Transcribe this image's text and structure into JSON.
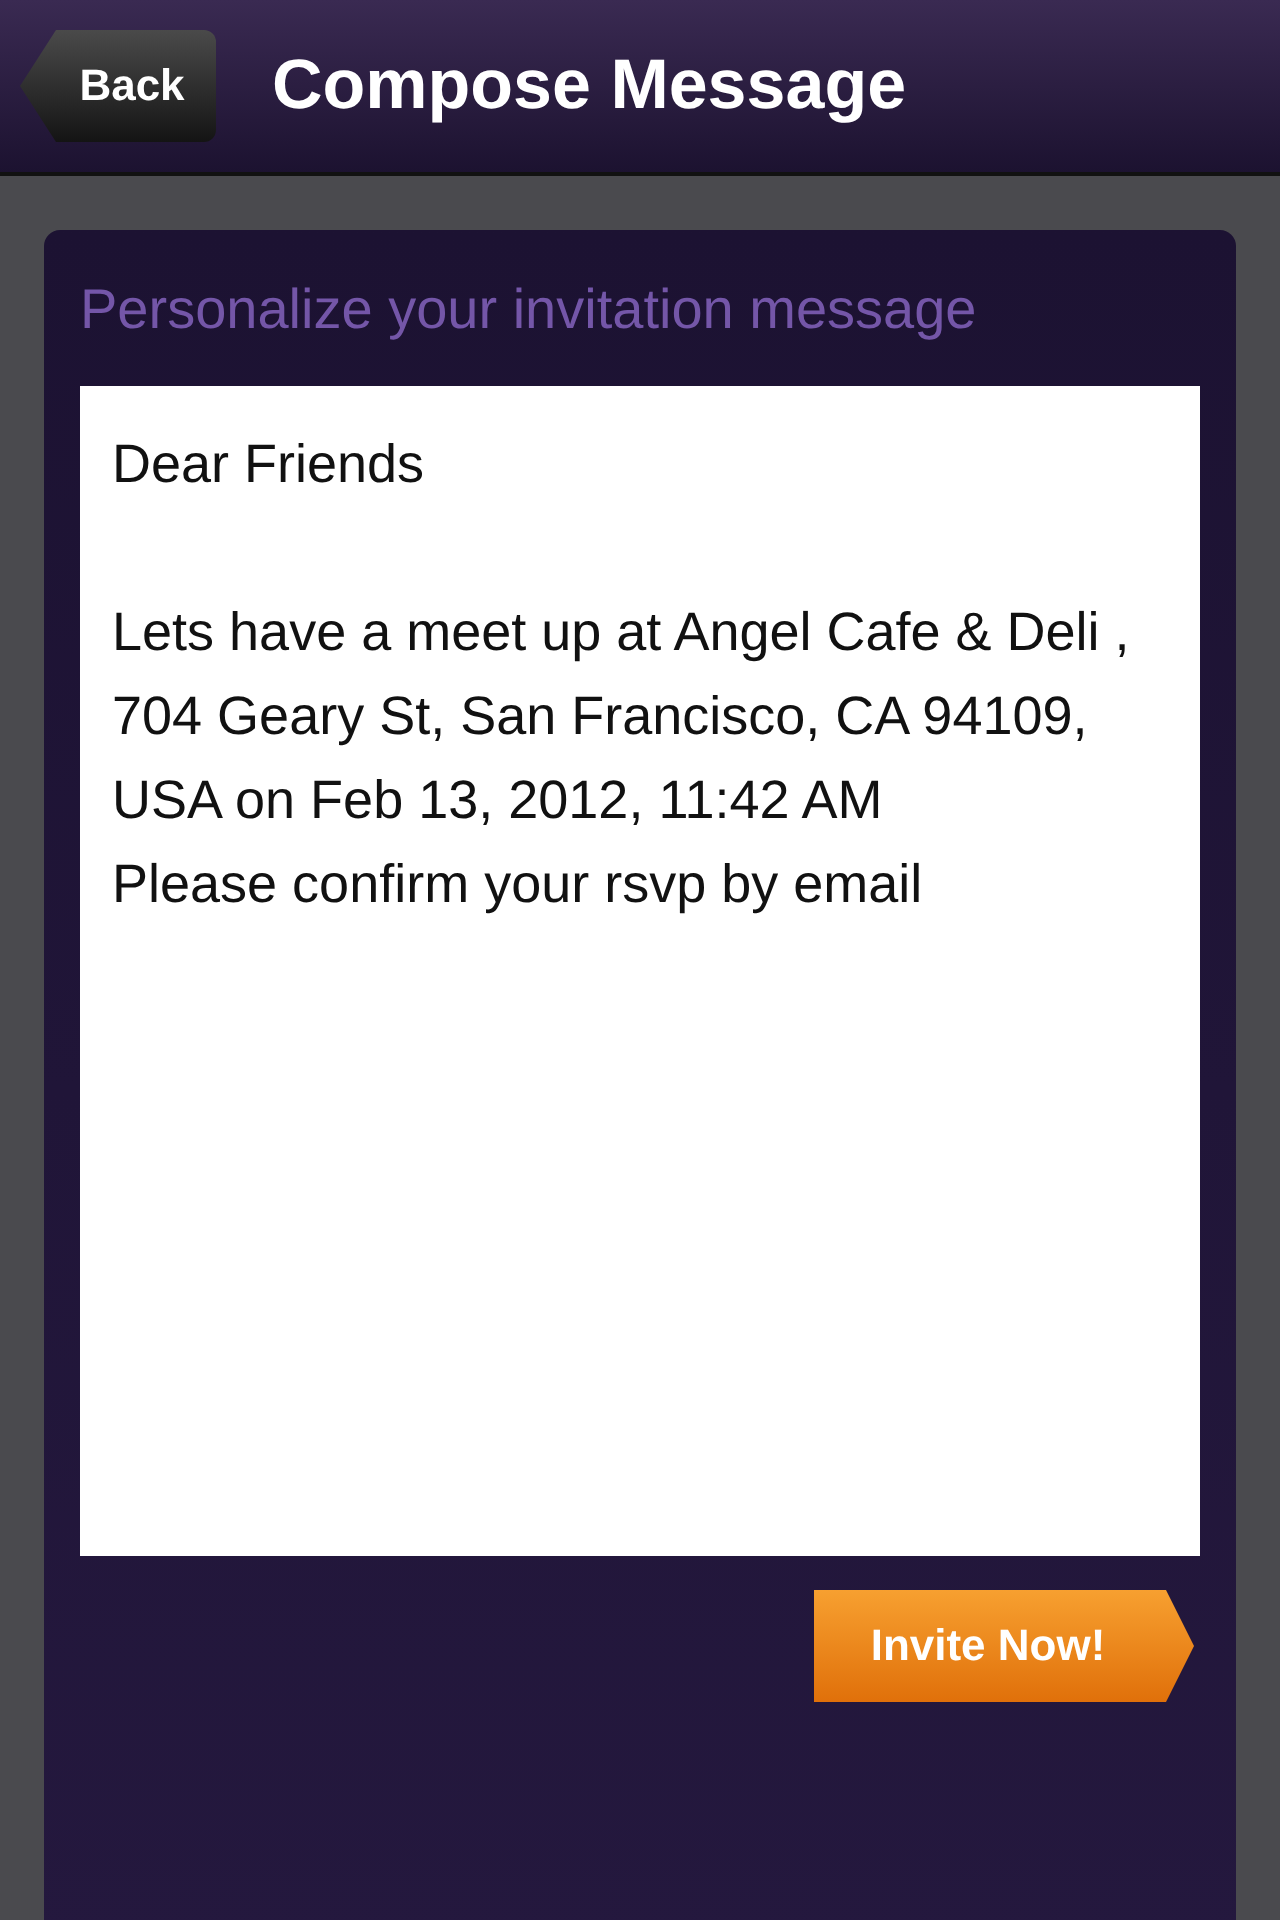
{
  "nav_bar": {
    "back_button": "Back",
    "title": "Compose Message"
  },
  "panel": {
    "heading": "Personalize your invitation message",
    "message": {
      "value": "Dear Friends\n\nLets have a meet up at Angel Cafe & Deli ,\n704 Geary St, San Francisco, CA 94109, USA on Feb 13, 2012, 11:42 AM\nPlease confirm your rsvp by email"
    },
    "invite_button": "Invite Now!"
  }
}
